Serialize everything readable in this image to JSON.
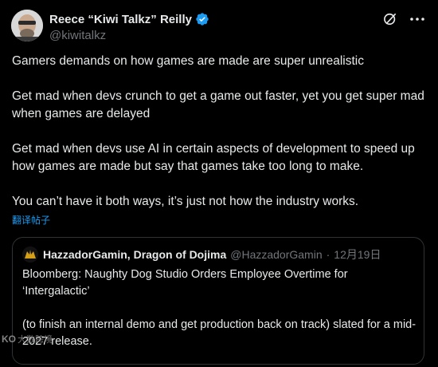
{
  "author": {
    "display_name": "Reece “Kiwi Talkz” Reilly",
    "handle": "@kiwitalkz",
    "verified": true,
    "verified_color": "#1d9bf0"
  },
  "actions": {
    "grok_icon": "grok-icon",
    "more_icon": "more-icon"
  },
  "tweet": {
    "paragraphs": [
      "Gamers demands on how games are made are super unrealistic",
      "Get mad when devs crunch to get a game out faster, yet you get super mad when games are delayed",
      "Get mad when devs use AI in certain aspects of development to speed up how games are made but say that games take too long to make.",
      "You can’t have it both ways, it’s just not how the industry works."
    ],
    "translate_label": "翻译帖子"
  },
  "quote": {
    "display_name": "HazzadorGamin, Dragon of Dojima",
    "handle": "@HazzadorGamin",
    "separator": "·",
    "date": "12月19日",
    "paragraphs": [
      "Bloomberg: Naughty Dog Studio Orders Employee Overtime for ‘Intergalactic’",
      "(to finish an internal demo and get production back on track) slated for a mid-2027 release."
    ]
  },
  "watermark": {
    "logo": "KO",
    "text": "大数跨境"
  },
  "colors": {
    "background": "#000000",
    "text": "#e7e9ea",
    "muted": "#71767b",
    "accent": "#1d9bf0",
    "border": "#2f3336"
  }
}
